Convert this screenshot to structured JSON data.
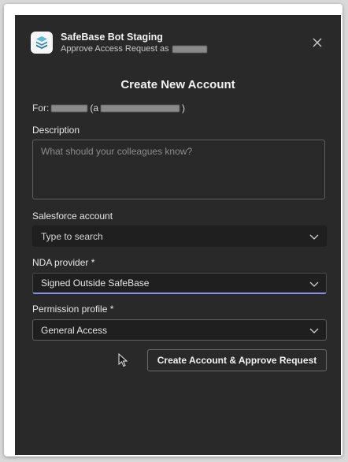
{
  "header": {
    "app_name": "SafeBase Bot Staging",
    "subtitle": "Approve Access Request as"
  },
  "dialog": {
    "title": "Create New Account",
    "for_prefix": "For:",
    "for_open_paren": "(a",
    "for_close_paren": ")"
  },
  "description": {
    "label": "Description",
    "placeholder": "What should your colleagues know?"
  },
  "salesforce": {
    "label": "Salesforce account",
    "placeholder": "Type to search"
  },
  "nda": {
    "label": "NDA provider *",
    "value": "Signed Outside SafeBase"
  },
  "permission": {
    "label": "Permission profile *",
    "value": "General Access"
  },
  "actions": {
    "submit_label": "Create Account & Approve Request"
  },
  "colors": {
    "background": "#292929",
    "focus_accent": "#8b8fe8"
  },
  "icons": {
    "app": "safebase-logo-icon",
    "close": "close-icon",
    "chevron": "chevron-down-icon",
    "cursor": "mouse-pointer-icon"
  }
}
